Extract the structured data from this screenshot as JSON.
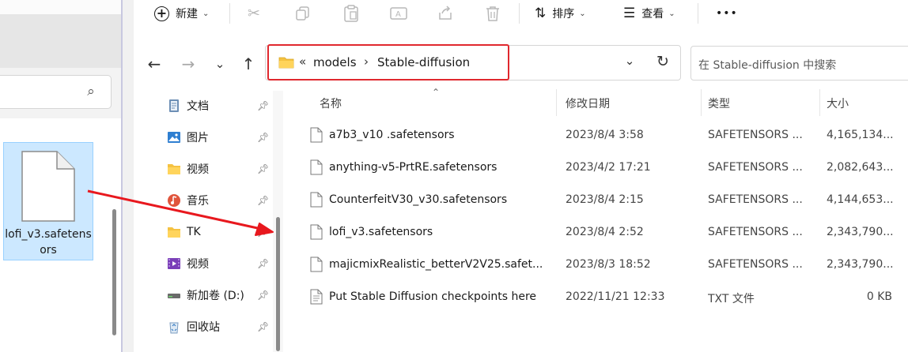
{
  "left_window": {
    "file_tile_label": "lofi_v3.safetensors",
    "search_icon": "search-icon"
  },
  "toolbar": {
    "new_label": "新建",
    "sort_label": "排序",
    "view_label": "查看",
    "more_label": "•••",
    "icons": [
      "plus-circle-icon",
      "cut-icon",
      "copy-icon",
      "paste-icon",
      "rename-icon",
      "share-icon",
      "delete-icon",
      "sort-icon",
      "view-icon",
      "more-icon"
    ]
  },
  "address": {
    "overflow": "«",
    "segments": [
      "models",
      "Stable-diffusion"
    ],
    "separator": "›"
  },
  "search": {
    "placeholder": "在 Stable-diffusion 中搜索"
  },
  "nav_pane": {
    "items": [
      {
        "label": "文档",
        "icon": "documents-icon",
        "pinned": true
      },
      {
        "label": "图片",
        "icon": "pictures-icon",
        "pinned": true
      },
      {
        "label": "视频",
        "icon": "folder-icon",
        "pinned": true
      },
      {
        "label": "音乐",
        "icon": "music-icon",
        "pinned": true
      },
      {
        "label": "TK",
        "icon": "folder-icon",
        "pinned": true
      },
      {
        "label": "视频",
        "icon": "videos-icon",
        "pinned": true
      },
      {
        "label": "新加卷 (D:)",
        "icon": "drive-icon",
        "pinned": true
      },
      {
        "label": "回收站",
        "icon": "recycle-bin-icon",
        "pinned": true
      }
    ]
  },
  "file_list": {
    "columns": [
      "名称",
      "修改日期",
      "类型",
      "大小"
    ],
    "rows": [
      {
        "name": "a7b3_v10 .safetensors",
        "date": "2023/8/4 3:58",
        "type": "SAFETENSORS ...",
        "size": "4,165,134..."
      },
      {
        "name": "anything-v5-PrtRE.safetensors",
        "date": "2023/4/2 17:21",
        "type": "SAFETENSORS ...",
        "size": "2,082,643..."
      },
      {
        "name": "CounterfeitV30_v30.safetensors",
        "date": "2023/8/4 2:15",
        "type": "SAFETENSORS ...",
        "size": "4,144,653..."
      },
      {
        "name": "lofi_v3.safetensors",
        "date": "2023/8/4 2:52",
        "type": "SAFETENSORS ...",
        "size": "2,343,790..."
      },
      {
        "name": "majicmixRealistic_betterV2V25.safet...",
        "date": "2023/8/3 18:52",
        "type": "SAFETENSORS ...",
        "size": "2,343,790..."
      },
      {
        "name": "Put Stable Diffusion checkpoints here",
        "date": "2022/11/21 12:33",
        "type": "TXT 文件",
        "size": "0 KB"
      }
    ]
  },
  "colors": {
    "accent_highlight": "#e0282e",
    "selection": "#cce8ff",
    "folder": "#f5c242"
  }
}
